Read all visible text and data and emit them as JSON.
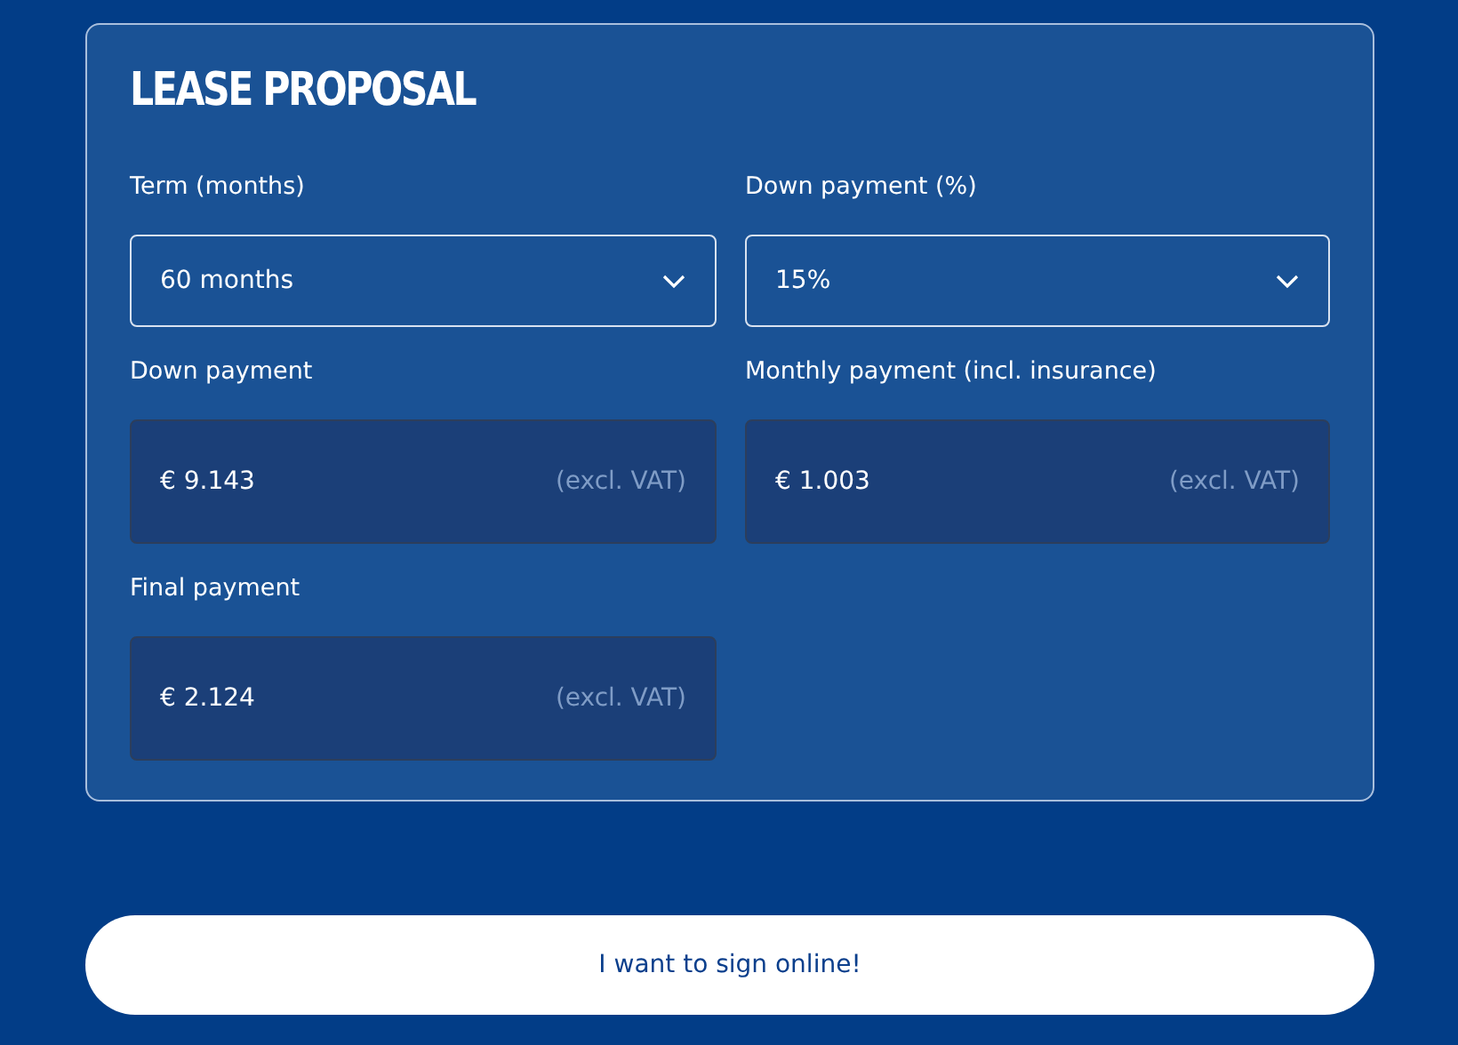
{
  "card": {
    "title": "LEASE PROPOSAL",
    "fields": [
      {
        "kind": "select",
        "label": "Term (months)",
        "value": "60 months"
      },
      {
        "kind": "select",
        "label": "Down payment (%)",
        "value": "15%"
      },
      {
        "kind": "output",
        "label": "Down payment",
        "value": "€ 9.143",
        "suffix": "(excl. VAT)"
      },
      {
        "kind": "output",
        "label": "Monthly payment (incl. insurance)",
        "value": "€ 1.003",
        "suffix": "(excl. VAT)"
      },
      {
        "kind": "output",
        "label": "Final payment",
        "value": "€ 2.124",
        "suffix": "(excl. VAT)"
      }
    ]
  },
  "button": {
    "label": "I want to sign online!"
  }
}
